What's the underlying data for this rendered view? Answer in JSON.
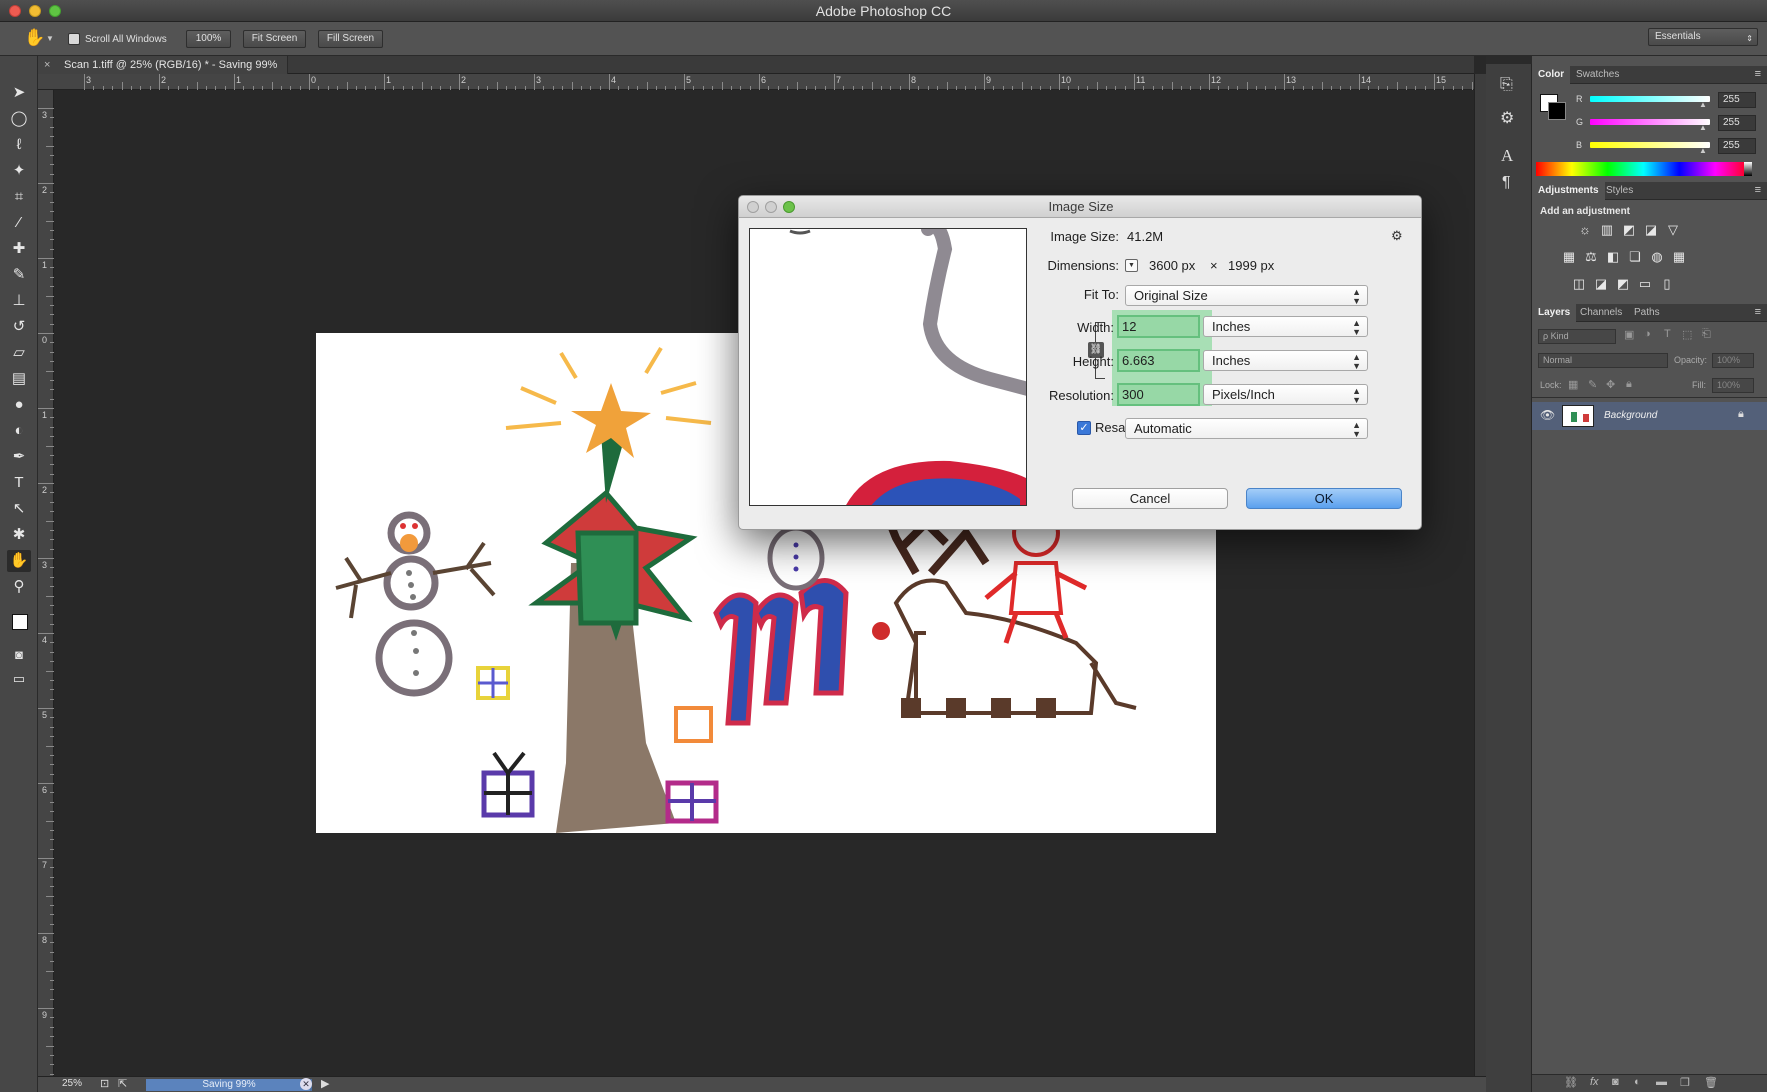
{
  "app": {
    "title": "Adobe Photoshop CC"
  },
  "options_bar": {
    "scroll_all_windows": "Scroll All Windows",
    "zoom_100": "100%",
    "fit_screen": "Fit Screen",
    "fill_screen": "Fill Screen",
    "workspace": "Essentials"
  },
  "document": {
    "tab_title": "Scan 1.tiff @ 25% (RGB/16) * - Saving 99%",
    "close_glyph": "×"
  },
  "rulers": {
    "horizontal": [
      "3",
      "2",
      "1",
      "0",
      "1",
      "2",
      "3",
      "4",
      "5",
      "6",
      "7",
      "8",
      "9",
      "10",
      "11",
      "12",
      "13",
      "14",
      "15"
    ],
    "vertical": [
      "3",
      "2",
      "1",
      "0",
      "1",
      "2",
      "3",
      "4",
      "5",
      "6",
      "7",
      "8",
      "9"
    ]
  },
  "status": {
    "zoom": "25%",
    "progress_label": "Saving 99%",
    "progress_fraction": 0.99
  },
  "color_panel": {
    "tabs": [
      "Color",
      "Swatches"
    ],
    "channels": [
      {
        "label": "R",
        "value": "255",
        "color": "#00ffff"
      },
      {
        "label": "G",
        "value": "255",
        "color": "#ff00ff"
      },
      {
        "label": "B",
        "value": "255",
        "color": "#ffff00"
      }
    ]
  },
  "adjustments_panel": {
    "tabs": [
      "Adjustments",
      "Styles"
    ],
    "heading": "Add an adjustment",
    "icons_row1": [
      "☼",
      "▥",
      "◩",
      "◪",
      "▽"
    ],
    "icons_row2": [
      "▦",
      "⚖",
      "◧",
      "❏",
      "◍",
      "▦"
    ],
    "icons_row3": [
      "◫",
      "◪",
      "◩",
      "▭"
    ]
  },
  "layers_panel": {
    "tabs": [
      "Layers",
      "Channels",
      "Paths"
    ],
    "kind": "ρ Kind",
    "blend_mode": "Normal",
    "opacity_label": "Opacity:",
    "opacity_value": "100%",
    "lock_label": "Lock:",
    "fill_label": "Fill:",
    "fill_value": "100%",
    "layers": [
      {
        "name": "Background"
      }
    ]
  },
  "dialog": {
    "title": "Image Size",
    "image_size_label": "Image Size:",
    "image_size_value": "41.2M",
    "dimensions_label": "Dimensions:",
    "dim_width": "3600 px",
    "dim_times": "×",
    "dim_height": "1999 px",
    "fit_to_label": "Fit To:",
    "fit_to_value": "Original Size",
    "width_label": "Width:",
    "width_value": "12",
    "width_unit": "Inches",
    "height_label": "Height:",
    "height_value": "6.663",
    "height_unit": "Inches",
    "resolution_label": "Resolution:",
    "resolution_value": "300",
    "resolution_unit": "Pixels/Inch",
    "resample_label": "Resample:",
    "resample_value": "Automatic",
    "cancel": "Cancel",
    "ok": "OK"
  }
}
